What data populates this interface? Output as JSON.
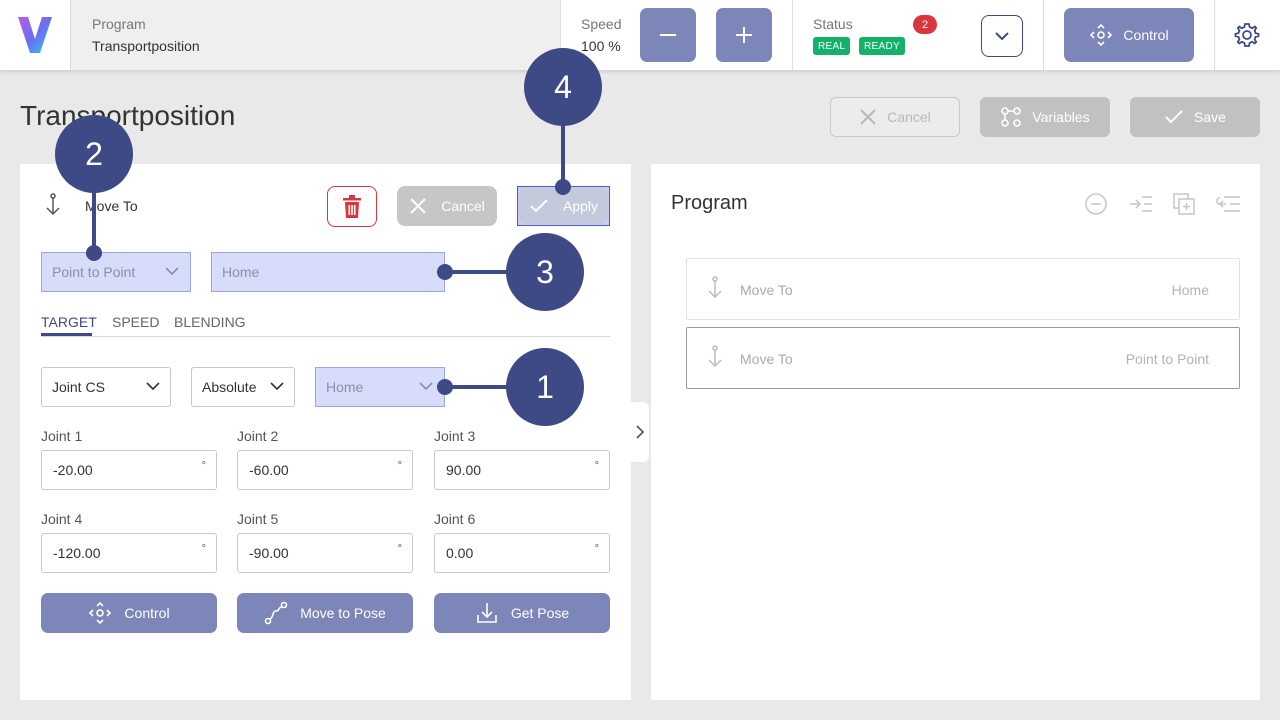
{
  "topbar": {
    "program_label": "Program",
    "program_value": "Transportposition",
    "speed_label": "Speed",
    "speed_value": "100 %",
    "status_label": "Status",
    "status_count": "2",
    "status_real": "REAL",
    "status_ready": "READY",
    "control_label": "Control"
  },
  "page": {
    "title": "Transportposition",
    "cancel_label": "Cancel",
    "variables_label": "Variables",
    "save_label": "Save"
  },
  "editor": {
    "step_title": "Move To",
    "cancel_label": "Cancel",
    "apply_label": "Apply",
    "motion_type": "Point to Point",
    "target_name": "Home",
    "tabs": [
      "TARGET",
      "SPEED",
      "BLENDING"
    ],
    "coord_system": "Joint CS",
    "mode": "Absolute",
    "position": "Home",
    "joints": [
      {
        "label": "Joint 1",
        "value": "-20.00",
        "unit": "°"
      },
      {
        "label": "Joint 2",
        "value": "-60.00",
        "unit": "°"
      },
      {
        "label": "Joint 3",
        "value": "90.00",
        "unit": "°"
      },
      {
        "label": "Joint 4",
        "value": "-120.00",
        "unit": "°"
      },
      {
        "label": "Joint 5",
        "value": "-90.00",
        "unit": "°"
      },
      {
        "label": "Joint 6",
        "value": "0.00",
        "unit": "°"
      }
    ],
    "actions": {
      "control": "Control",
      "move_to_pose": "Move to Pose",
      "get_pose": "Get Pose"
    }
  },
  "program_panel": {
    "title": "Program",
    "steps": [
      {
        "name": "Move To",
        "value": "Home"
      },
      {
        "name": "Move To",
        "value": "Point to Point"
      }
    ]
  },
  "callouts": [
    "1",
    "2",
    "3",
    "4"
  ],
  "colors": {
    "accent": "#3e4a85",
    "button": "#7c86b8",
    "highlight": "#d6dcfa",
    "ready": "#13b16a",
    "danger": "#d9363e"
  }
}
